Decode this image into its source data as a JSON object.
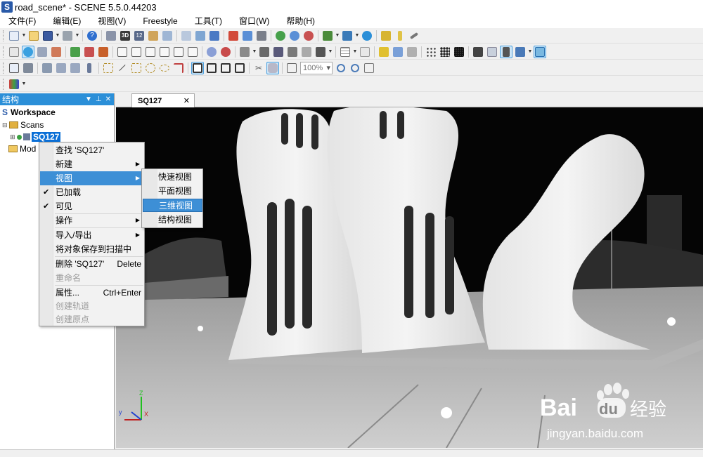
{
  "window": {
    "title": "road_scene* - SCENE 5.5.0.44203",
    "icon_letter": "S"
  },
  "menu": [
    "文件(F)",
    "编辑(E)",
    "视图(V)",
    "Freestyle",
    "工具(T)",
    "窗口(W)",
    "帮助(H)"
  ],
  "toolbar": {
    "zoom_value": "100%",
    "badge_3d": "3D",
    "badge_12": "12"
  },
  "panel": {
    "title": "结构",
    "tree": {
      "workspace": "Workspace",
      "scans": "Scans",
      "scan_item": "SQ127",
      "models": "Mod"
    }
  },
  "viewport": {
    "tab_label": "SQ127",
    "axis_z": "Z",
    "axis_x": "X",
    "axis_y": "y"
  },
  "context_menu": {
    "items": [
      {
        "label": "查找 'SQ127'"
      },
      {
        "label": "新建"
      },
      {
        "label": "视图"
      },
      {
        "label": "已加载"
      },
      {
        "label": "可见"
      },
      {
        "label": "操作"
      },
      {
        "label": "导入/导出"
      },
      {
        "label": "将对象保存到扫描中"
      },
      {
        "label": "删除 'SQ127'",
        "shortcut": "Delete"
      },
      {
        "label": "重命名"
      },
      {
        "label": "属性...",
        "shortcut": "Ctrl+Enter"
      },
      {
        "label": "创建轨道"
      },
      {
        "label": "创建原点"
      }
    ],
    "check_mark": "✔",
    "submenu": [
      "快速视图",
      "平面视图",
      "三维视图",
      "结构视图"
    ]
  },
  "watermark": {
    "brand_left": "Bai",
    "brand_right": "du",
    "brand_cn": "经验",
    "url": "jingyan.baidu.com"
  },
  "colors": {
    "selection": "#3d8fd6",
    "panel_header": "#2b8fd8",
    "tree_selected": "#0a6fd6"
  }
}
